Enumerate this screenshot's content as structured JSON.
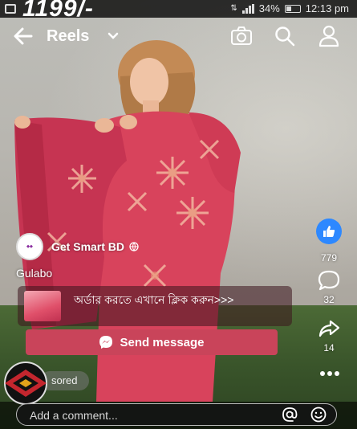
{
  "status_bar": {
    "overlay_price": "1199/-",
    "battery": "34%",
    "time": "12:13 pm"
  },
  "top_bar": {
    "title": "Reels",
    "icons": [
      "back-arrow-icon",
      "chevron-down-icon",
      "camera-icon",
      "search-icon",
      "profile-icon"
    ]
  },
  "actions": {
    "like_count": "779",
    "comment_count": "32",
    "share_count": "14",
    "icons": [
      "like-icon",
      "comment-icon",
      "share-icon",
      "more-icon"
    ]
  },
  "post": {
    "author": "Get Smart BD",
    "caption": "Gulabo"
  },
  "ad": {
    "text": "অর্ডার করতে এখানে ক্লিক করুন>>>",
    "send_label": "Send message"
  },
  "sponsored_label": "sored",
  "comment": {
    "placeholder": "Add a comment..."
  },
  "colors": {
    "like_blue": "#2d88ff",
    "send_button": "#c9445a",
    "dress_pink": "#d8435c"
  }
}
